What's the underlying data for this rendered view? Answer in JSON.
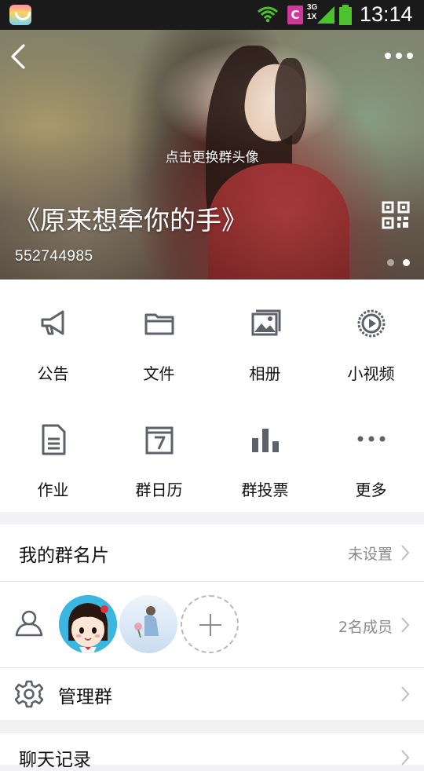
{
  "status_bar": {
    "network_label": "3G\n1X",
    "c_badge": "C",
    "time": "13:14",
    "colors": {
      "battery": "#4cc22c",
      "wifi": "#4cc22c",
      "c_badge": "#d0399a"
    }
  },
  "hero": {
    "change_avatar_hint": "点击更换群头像",
    "group_name": "《原来想牵你的手》",
    "group_id": "552744985",
    "icons": {
      "back": "back-arrow-icon",
      "more": "more-dots-icon",
      "qr": "qr-code-icon"
    },
    "pager": {
      "count": 2,
      "active": 2
    }
  },
  "tools": [
    {
      "label": "公告",
      "icon": "megaphone-icon"
    },
    {
      "label": "文件",
      "icon": "folder-icon"
    },
    {
      "label": "相册",
      "icon": "photo-album-icon"
    },
    {
      "label": "小视频",
      "icon": "video-play-icon"
    },
    {
      "label": "作业",
      "icon": "document-icon"
    },
    {
      "label": "群日历",
      "icon": "calendar-icon"
    },
    {
      "label": "群投票",
      "icon": "bar-chart-icon"
    },
    {
      "label": "更多",
      "icon": "more-dots-icon"
    }
  ],
  "my_card": {
    "label": "我的群名片",
    "value": "未设置"
  },
  "members": {
    "count_text": "2名成员"
  },
  "manage": {
    "label": "管理群"
  },
  "next_row": {
    "label": "聊天记录"
  },
  "colors": {
    "icon_gray": "#5d6169",
    "accent_text": "#111111",
    "secondary_text": "#8a8a8a"
  }
}
